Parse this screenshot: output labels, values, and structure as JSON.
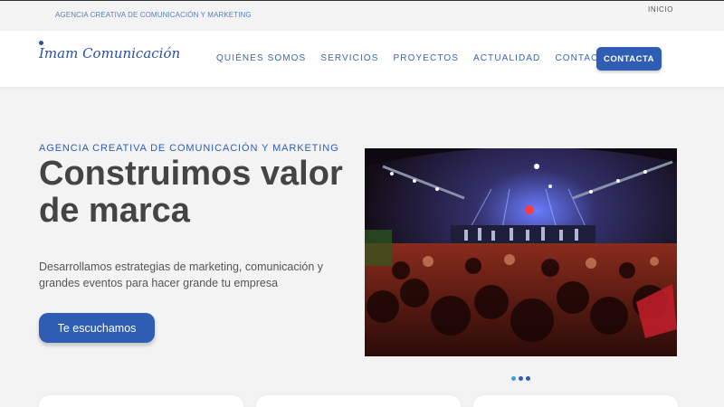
{
  "topbar": {
    "tagline": "AGENCIA CREATIVA DE COMUNICACIÓN Y MARKETING",
    "inicio_link": "INICIO"
  },
  "header": {
    "logo_text": "Imam Comunicación",
    "nav": [
      {
        "label": "QUIÉNES SOMOS"
      },
      {
        "label": "SERVICIOS"
      },
      {
        "label": "PROYECTOS"
      },
      {
        "label": "ACTUALIDAD"
      },
      {
        "label": "CONTACTO"
      }
    ],
    "cta_label": "CONTACTA"
  },
  "hero": {
    "kicker": "AGENCIA CREATIVA DE COMUNICACIÓN Y MARKETING",
    "title": "Construimos valor de marca",
    "description": "Desarrollamos estrategias de marketing, comunicación y grandes eventos para hacer grande tu empresa",
    "button_label": "Te escuchamos",
    "image_subject": "concert-crowd-stage-photo"
  },
  "slider": {
    "slides": 3,
    "active": 1
  },
  "colors": {
    "brand": "#2f5db4",
    "accent": "#3da0d8",
    "text_dark": "#444444"
  }
}
